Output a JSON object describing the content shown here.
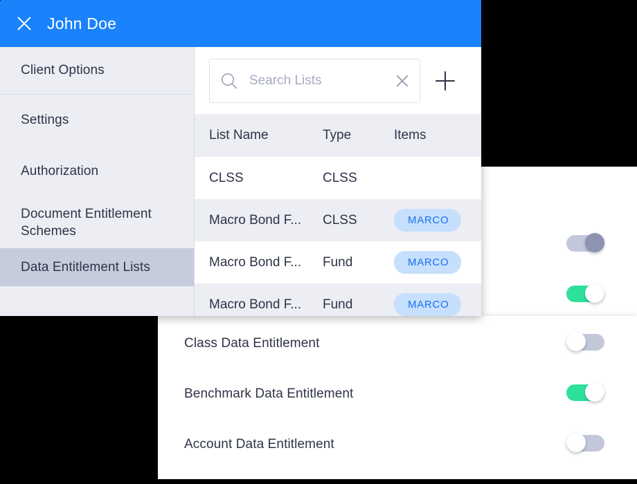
{
  "window": {
    "title": "John Doe",
    "close_icon": "close-icon",
    "header_color": "#1a82fb"
  },
  "sidebar": {
    "items": [
      {
        "label": "Client Options",
        "active": false
      },
      {
        "label": "Settings",
        "active": false
      },
      {
        "label": "Authorization",
        "active": false
      },
      {
        "label": "Document Entitlement Schemes",
        "active": false
      },
      {
        "label": "Data Entitlement Lists",
        "active": true
      }
    ]
  },
  "search": {
    "placeholder": "Search Lists",
    "value": "",
    "search_icon": "search-icon",
    "clear_icon": "clear-icon",
    "add_icon": "plus-icon"
  },
  "table": {
    "columns": [
      "List Name",
      "Type",
      "Items"
    ],
    "rows": [
      {
        "name": "CLSS",
        "type": "CLSS",
        "items": ""
      },
      {
        "name": "Macro Bond F...",
        "type": "CLSS",
        "items": "MARCO"
      },
      {
        "name": "Macro Bond F...",
        "type": "Fund",
        "items": "MARCO"
      },
      {
        "name": "Macro Bond F...",
        "type": "Fund",
        "items": "MARCO"
      }
    ]
  },
  "entitlements": {
    "rows": [
      {
        "label": "",
        "state": "on",
        "muted": true
      },
      {
        "label": "",
        "state": "on",
        "muted": false
      },
      {
        "label": "Class Data Entitlement",
        "state": "off",
        "muted": false
      },
      {
        "label": "Benchmark Data Entitlement",
        "state": "on",
        "muted": false
      },
      {
        "label": "Account Data Entitlement",
        "state": "off",
        "muted": false
      }
    ]
  },
  "colors": {
    "accent_blue": "#1a82fb",
    "toggle_on_green": "#2fe09b",
    "toggle_track_grey": "#c2c8da",
    "toggle_knob_muted": "#8d93b0",
    "chip_bg": "#c6dffc",
    "chip_text": "#1a6ff0",
    "panel_grey": "#eceef4",
    "sidebar_active": "#c7ccdc",
    "text_primary": "#2e3347",
    "background": "#000000"
  }
}
